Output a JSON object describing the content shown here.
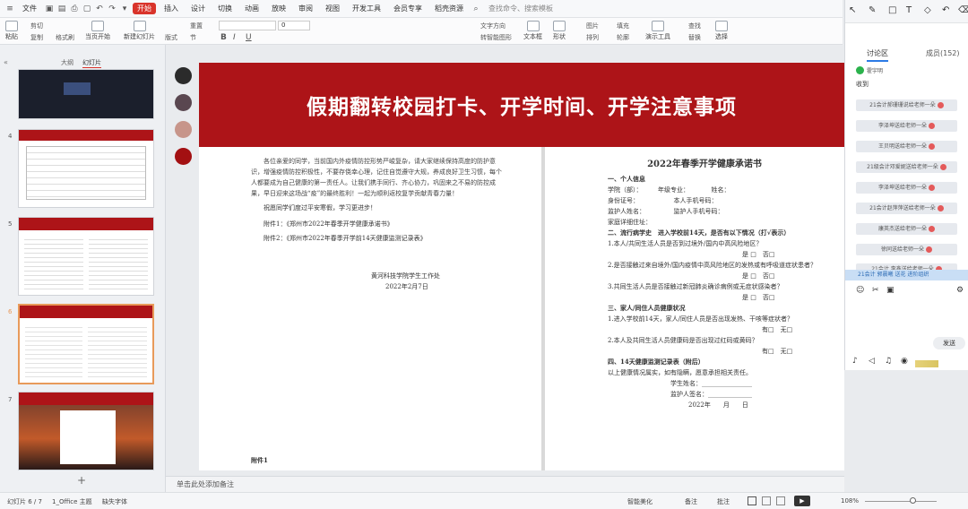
{
  "menu": {
    "file": "文件",
    "tabs": [
      "开始",
      "插入",
      "设计",
      "切换",
      "动画",
      "放映",
      "审阅",
      "视图",
      "开发工具",
      "会员专享",
      "稻壳资源"
    ],
    "search": "查找命令、搜索模板"
  },
  "ribbon": {
    "paste": "粘贴",
    "cut": "剪切",
    "copy": "复制",
    "format_painter": "格式刷",
    "slide_start": "当页开始",
    "new_slide": "新建幻灯片",
    "layout": "版式",
    "section": "节",
    "reset": "重置",
    "font_size": "0",
    "bold": "B",
    "italic": "I",
    "underline": "U",
    "text_direction": "文字方向",
    "align_text": "对齐文本",
    "smartart": "转智能图形",
    "textbox": "文本框",
    "shape": "形状",
    "arrange": "排列",
    "outline": "轮廓",
    "picture": "图片",
    "fill": "填充",
    "presenter": "演示工具",
    "find": "查找",
    "replace": "替换",
    "select": "选择"
  },
  "panel": {
    "tab_outline": "大纲",
    "tab_slides": "幻灯片",
    "slide_numbers": [
      "",
      "4",
      "5",
      "6",
      "7"
    ],
    "add": "+"
  },
  "slide": {
    "title": "假期翻转校园打卡、开学时间、开学注意事项",
    "left_doc": {
      "paragraphs": [
        "各位亲爱的同学，当前国内外疫情防控形势严峻复杂，请大家继续保持高度的防护意识，增强疫情防控积极性，不要存侥幸心理，记住自觉遵守大规，养成良好卫生习惯，每个人都要成为自己健康的第一责任人。让我们携手同行、齐心协力，巩固来之不易的防控成果，早日迎来这场战“疫”的最终胜利！一起为顺利返校复学贡献青春力量！",
        "祝愿同学们度过平安寒假，学习更进步！"
      ],
      "attachment1": "附件1：《郑州市2022年春季开学健康承诺书》",
      "attachment2": "附件2：《郑州市2022年春季开学前14天健康监测记录表》",
      "org": "黄河科技学院学生工作处",
      "date": "2022年2月7日",
      "appendix": "附件1"
    },
    "right_doc": {
      "title": "2022年春季开学健康承诺书",
      "sec1": "一、个人信息",
      "line1": "学院（部）：　　　年级专业：　　　　姓名：",
      "line2": "身份证号：　　　　　　本人手机号码：",
      "line3": "监护人姓名：　　　　　监护人手机号码：",
      "line4": "家庭详细住址：",
      "sec2": "二、流行病学史　进入学校前14天，是否有以下情况（打√表示）",
      "q1": "1.本人/共同生活人员是否到过境外/国内中高风险地区？",
      "q2": "2.是否接触过来自境外/国内疫情中高风险地区的发热或有呼吸道症状患者？",
      "q3": "3.共同生活人员是否接触过新冠肺炎确诊病例或无症状感染者？",
      "yesno": "是 □　否□",
      "sec3": "三、家人/同住人员健康状况",
      "q4": "1.进入学校前14天，家人/同住人员是否出现发热、干咳等症状者？",
      "q5": "2.本人及共同生活人员健康码是否出现过红码或黄码？",
      "yesno2": "有□　无□",
      "sec4": "四、14天健康监测记录表（附后）",
      "pledge": "以上健康情况属实，如有隐瞒，愿意承担相关责任。",
      "student_sign": "学生姓名：",
      "guardian_sign": "监护人签名：",
      "date": "2022年　　月　　日"
    }
  },
  "notes": {
    "placeholder": "单击此处添加备注"
  },
  "status": {
    "slide": "幻灯片 6 / 7",
    "theme": "1_Office 主题",
    "missing_font": "缺失字体",
    "beautify": "智能美化",
    "notes": "备注",
    "comments": "批注",
    "zoom": "108%"
  },
  "chat": {
    "tab_discussion": "讨论区",
    "tab_members": "成员(152)",
    "sender": "霍宇明",
    "received": "收到",
    "messages": [
      "21会计郝珊珊说给老师一朵",
      "李泽坤送给老师一朵",
      "王贝明送给老师一朵",
      "21级会计邓爱妮送给老师一朵",
      "李泽坤送给老师一朵",
      "21会计赵萍萍送给老师一朵",
      "康英杰送给老师一朵",
      "徐同送给老师一朵",
      "21会计 李鑫送给老师一朵"
    ],
    "banner": "21会计 郭晨曦 送花 进阶组织",
    "send": "发送"
  },
  "colors": {
    "accent": "#d9342b",
    "banner": "#ad1418",
    "swatch1": "#2b2b2b",
    "swatch2": "#5a4750",
    "swatch3": "#c7958a",
    "swatch4": "#a31012"
  }
}
